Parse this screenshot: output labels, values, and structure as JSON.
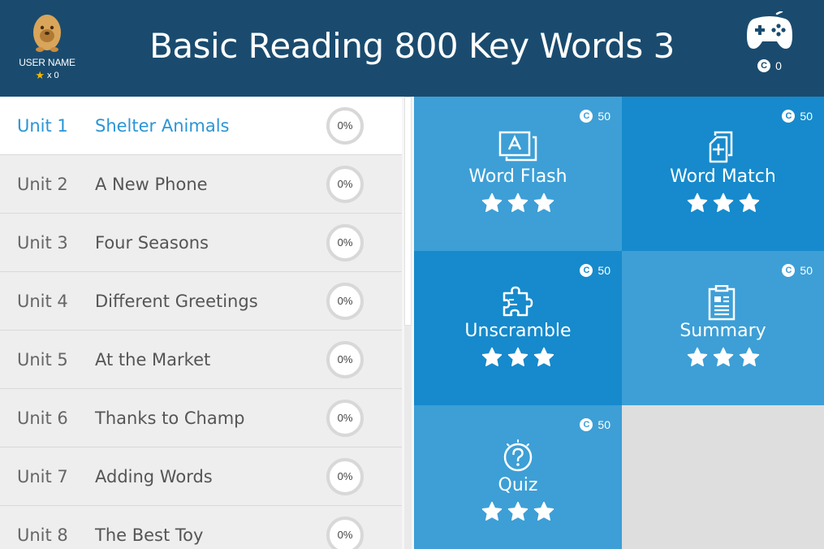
{
  "header": {
    "title": "Basic Reading 800 Key Words 3",
    "user_name": "USER NAME",
    "stars_count": "x 0",
    "coins": "0",
    "game_icon": "gamepad-icon",
    "avatar_icon": "egg-character-avatar"
  },
  "units": [
    {
      "num": "Unit 1",
      "title": "Shelter Animals",
      "progress": "0%",
      "active": true
    },
    {
      "num": "Unit 2",
      "title": "A New Phone",
      "progress": "0%"
    },
    {
      "num": "Unit 3",
      "title": "Four Seasons",
      "progress": "0%"
    },
    {
      "num": "Unit 4",
      "title": "Different Greetings",
      "progress": "0%"
    },
    {
      "num": "Unit 5",
      "title": "At the Market",
      "progress": "0%"
    },
    {
      "num": "Unit 6",
      "title": "Thanks to Champ",
      "progress": "0%"
    },
    {
      "num": "Unit 7",
      "title": "Adding Words",
      "progress": "0%"
    },
    {
      "num": "Unit 8",
      "title": "The Best Toy",
      "progress": "0%"
    }
  ],
  "activities": [
    {
      "label": "Word Flash",
      "cost": "50",
      "icon": "flashcard-icon",
      "stars": 3
    },
    {
      "label": "Word Match",
      "cost": "50",
      "icon": "card-plus-icon",
      "stars": 3
    },
    {
      "label": "Unscramble",
      "cost": "50",
      "icon": "puzzle-icon",
      "stars": 3
    },
    {
      "label": "Summary",
      "cost": "50",
      "icon": "clipboard-icon",
      "stars": 3
    },
    {
      "label": "Quiz",
      "cost": "50",
      "icon": "question-icon",
      "stars": 3
    }
  ],
  "colors": {
    "header_bg": "#1a4b6e",
    "accent": "#2b95d6",
    "tile_light": "#3d9fd6",
    "tile_dark": "#168acc",
    "star": "#f5b800"
  }
}
